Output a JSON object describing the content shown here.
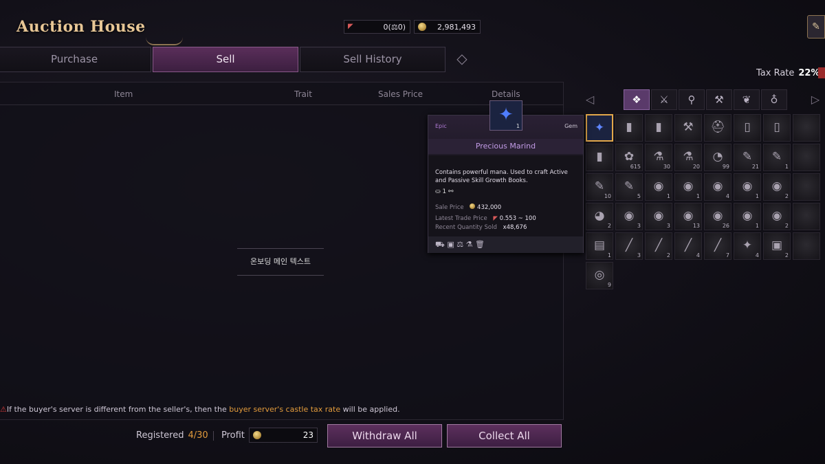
{
  "app": {
    "title": "Auction House"
  },
  "currency": {
    "mark": {
      "value": "0(⚖0)",
      "icon": "trade-mark-icon"
    },
    "gold": {
      "value": "2,981,493",
      "icon": "gold-coin-icon"
    }
  },
  "tabs": [
    {
      "label": "Purchase",
      "active": false
    },
    {
      "label": "Sell",
      "active": true
    },
    {
      "label": "Sell History",
      "active": false
    }
  ],
  "tax": {
    "label": "Tax Rate",
    "value": "22%"
  },
  "table": {
    "headers": [
      "Item",
      "Trait",
      "Sales Price",
      "Details"
    ],
    "placeholder": "온보딩 메인 텍스트"
  },
  "notice": {
    "prefix": "If the buyer's server is different from the seller's, then the",
    "highlight": "buyer server's castle tax rate",
    "suffix": "will be applied."
  },
  "footer": {
    "registered_label": "Registered",
    "registered_value": "4/30",
    "profit_label": "Profit",
    "profit_value": "23",
    "withdraw_label": "Withdraw All",
    "collect_label": "Collect All"
  },
  "inventory": {
    "tabs": [
      "all-items-icon",
      "weapon-icon",
      "potion-icon",
      "anvil-icon",
      "herb-icon",
      "pouch-icon"
    ],
    "active_tab": 0,
    "rows": [
      [
        {
          "i": "✦",
          "c": "",
          "sel": true
        },
        {
          "i": "▮",
          "c": ""
        },
        {
          "i": "▮",
          "c": ""
        },
        {
          "i": "⚒",
          "c": ""
        },
        {
          "i": "⛑",
          "c": ""
        },
        {
          "i": "▯",
          "c": ""
        },
        {
          "i": "▯",
          "c": ""
        },
        {
          "i": "",
          "c": ""
        }
      ],
      [
        {
          "i": "▮",
          "c": ""
        },
        {
          "i": "✿",
          "c": "615"
        },
        {
          "i": "⚗",
          "c": "30"
        },
        {
          "i": "⚗",
          "c": "20"
        },
        {
          "i": "◔",
          "c": "99"
        },
        {
          "i": "✎",
          "c": "21"
        },
        {
          "i": "✎",
          "c": "1"
        },
        {
          "i": "",
          "c": ""
        }
      ],
      [
        {
          "i": "✎",
          "c": "10"
        },
        {
          "i": "✎",
          "c": "5"
        },
        {
          "i": "◉",
          "c": "1"
        },
        {
          "i": "◉",
          "c": "1"
        },
        {
          "i": "◉",
          "c": "4"
        },
        {
          "i": "◉",
          "c": "1"
        },
        {
          "i": "◉",
          "c": "2"
        },
        {
          "i": "",
          "c": ""
        }
      ],
      [
        {
          "i": "◕",
          "c": "2"
        },
        {
          "i": "◉",
          "c": "3"
        },
        {
          "i": "◉",
          "c": "3"
        },
        {
          "i": "◉",
          "c": "13"
        },
        {
          "i": "◉",
          "c": "26"
        },
        {
          "i": "◉",
          "c": "1"
        },
        {
          "i": "◉",
          "c": "2"
        },
        {
          "i": "",
          "c": ""
        }
      ],
      [
        {
          "i": "▤",
          "c": "1"
        },
        {
          "i": "╱",
          "c": "3"
        },
        {
          "i": "╱",
          "c": "2"
        },
        {
          "i": "╱",
          "c": "4"
        },
        {
          "i": "╱",
          "c": "7"
        },
        {
          "i": "✦",
          "c": "4"
        },
        {
          "i": "▣",
          "c": "2"
        },
        {
          "i": "",
          "c": ""
        }
      ],
      [
        {
          "i": "◎",
          "c": "9"
        }
      ]
    ]
  },
  "tooltip": {
    "rarity": "Epic",
    "type": "Gem",
    "name": "Precious Marind",
    "count": "1",
    "description": "Contains powerful mana. Used to craft Active and Passive Skill Growth Books.",
    "bind_count": "1",
    "sale_price_label": "Sale Price",
    "sale_price": "432,000",
    "latest_trade_label": "Latest Trade Price",
    "latest_trade": "0.553 ~ 100",
    "recent_qty_label": "Recent Quantity Sold",
    "recent_qty": "x48,676",
    "actions": [
      "storage-icon",
      "box-icon",
      "scale-icon",
      "flask-icon",
      "trash-icon"
    ]
  }
}
